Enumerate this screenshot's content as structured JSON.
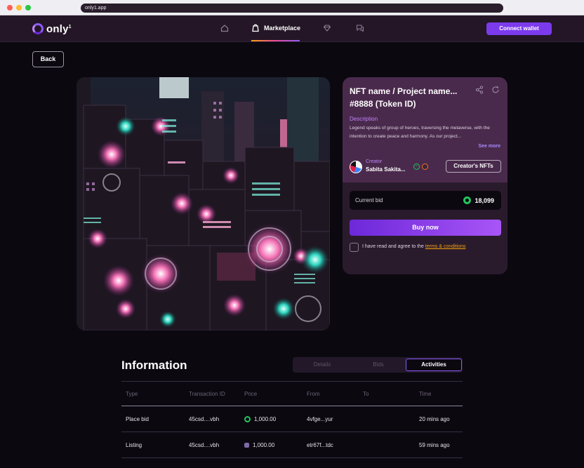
{
  "browser": {
    "url": "only1.app"
  },
  "nav": {
    "brand": "only",
    "brand_sup": "1",
    "active_label": "Marketplace",
    "connect_label": "Connect wallet",
    "icons": [
      "home-icon",
      "marketplace-icon",
      "diamond-icon",
      "chat-icon"
    ]
  },
  "back_label": "Back",
  "nft": {
    "title": "NFT name / Project name... #8888 (Token ID)",
    "description_label": "Description",
    "description": "Legend speaks of group of heroes, traversing the metaverse, with the intention to create peace and harmony. As our project...",
    "see_more": "See more",
    "creator_label": "Creator",
    "creator_name": "Sabita Sakita...",
    "creators_button": "Creator's NFTs",
    "current_bid_label": "Current bid",
    "current_bid_value": "18,099",
    "buy_label": "Buy now",
    "agree_text": "I have read and agree to the ",
    "terms_text": "terms & conditions"
  },
  "info": {
    "title": "Information",
    "tabs": [
      "Details",
      "Bids",
      "Activities"
    ],
    "active_tab": "Activities",
    "columns": [
      "Type",
      "Transaction ID",
      "Price",
      "From",
      "To",
      "Time"
    ],
    "rows": [
      {
        "type": "Place bid",
        "tx": "45csd....vbh",
        "price": "1,000.00",
        "from": "4vfge...yur",
        "to": "",
        "time": "20 mins ago"
      },
      {
        "type": "Listing",
        "tx": "45csd....vbh",
        "price": "1,000.00",
        "from": "etr67f...tdc",
        "to": "",
        "time": "59 mins ago"
      }
    ]
  },
  "colors": {
    "accent": "#7c3aed",
    "panel": "#2a1b2c",
    "terms": "#f59e0b",
    "coin": "#22c55e"
  }
}
